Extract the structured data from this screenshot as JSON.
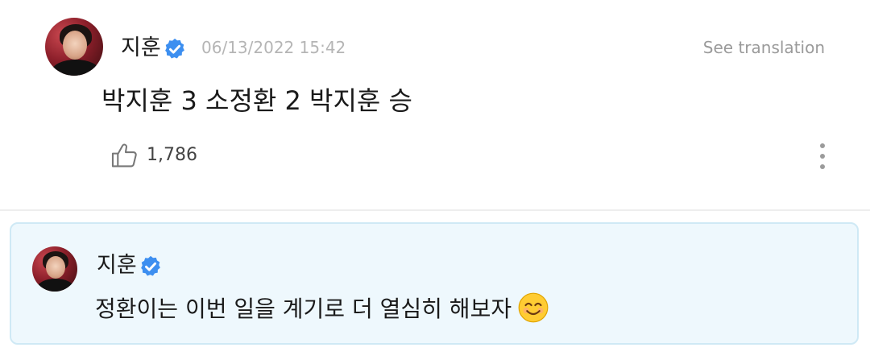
{
  "post": {
    "author": "지훈",
    "verified": true,
    "timestamp": "06/13/2022 15:42",
    "translate_label": "See translation",
    "text": "박지훈 3 소정환 2 박지훈 승",
    "like_count": "1,786",
    "icons": {
      "like": "thumbs-up-icon",
      "more": "more-vertical-icon",
      "verified": "verified-badge-icon"
    }
  },
  "reply": {
    "author": "지훈",
    "verified": true,
    "text": "정환이는 이번 일을 계기로 더 열심히 해보자",
    "emoji": "smiling-face-emoji"
  },
  "colors": {
    "verified_blue": "#3d8ff0",
    "reply_background": "#eef8fd",
    "reply_border": "#cfe9f5",
    "timestamp_gray": "#b5b5b5"
  }
}
